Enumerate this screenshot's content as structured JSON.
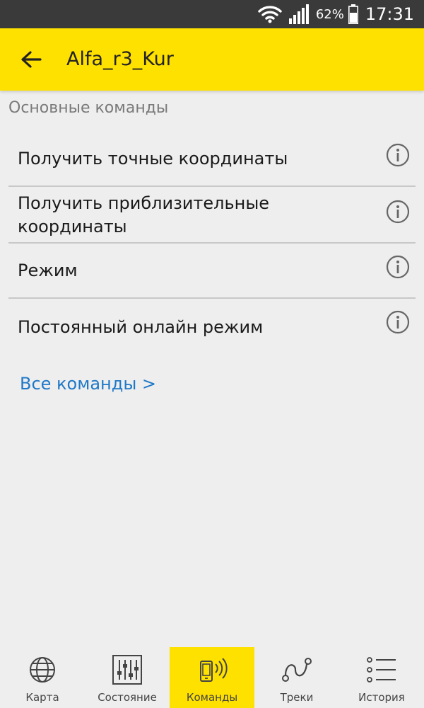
{
  "status_bar": {
    "battery_percent": "62%",
    "time": "17:31",
    "icons": [
      "wifi-icon",
      "signal-icon",
      "battery-icon"
    ]
  },
  "app_bar": {
    "title": "Alfa_r3_Kur",
    "back_icon": "arrow-left-icon",
    "background_color": "#ffe100"
  },
  "section": {
    "title": "Основные команды"
  },
  "commands": [
    {
      "label": "Получить точные координаты",
      "icon": "info-icon"
    },
    {
      "label": "Получить приблизительные координаты",
      "icon": "info-icon"
    },
    {
      "label": "Режим",
      "icon": "info-icon"
    },
    {
      "label": "Постоянный онлайн режим",
      "icon": "info-icon"
    }
  ],
  "all_commands_link": "Все команды >",
  "link_color": "#1f78c8",
  "bottom_nav": {
    "active_index": 2,
    "items": [
      {
        "label": "Карта",
        "icon": "globe-icon"
      },
      {
        "label": "Состояние",
        "icon": "sliders-icon"
      },
      {
        "label": "Команды",
        "icon": "phone-signal-icon"
      },
      {
        "label": "Треки",
        "icon": "track-icon"
      },
      {
        "label": "История",
        "icon": "list-icon"
      }
    ]
  }
}
